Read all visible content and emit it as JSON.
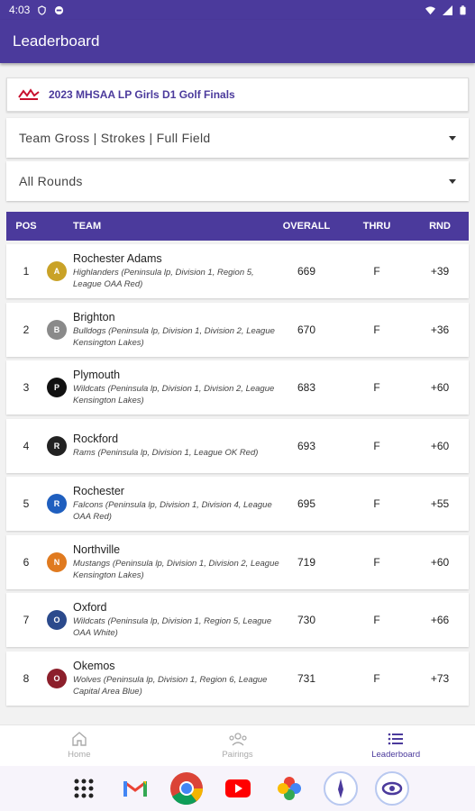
{
  "status": {
    "time": "4:03"
  },
  "appbar": {
    "title": "Leaderboard"
  },
  "event": {
    "title": "2023 MHSAA LP Girls D1 Golf Finals"
  },
  "filters": {
    "view": "Team Gross | Strokes | Full Field",
    "rounds": "All Rounds"
  },
  "table": {
    "headers": {
      "pos": "POS",
      "team": "TEAM",
      "overall": "OVERALL",
      "thru": "THRU",
      "rnd": "RND"
    },
    "rows": [
      {
        "pos": "1",
        "name": "Rochester Adams",
        "desc": "Highlanders (Peninsula lp, Division 1, Region 5, League OAA Red)",
        "overall": "669",
        "thru": "F",
        "rnd": "+39",
        "logo_color": "#c9a227",
        "logo_text": "A"
      },
      {
        "pos": "2",
        "name": "Brighton",
        "desc": "Bulldogs (Peninsula lp, Division 1, Division 2, League Kensington Lakes)",
        "overall": "670",
        "thru": "F",
        "rnd": "+36",
        "logo_color": "#8a8a8a",
        "logo_text": "B"
      },
      {
        "pos": "3",
        "name": "Plymouth",
        "desc": "Wildcats (Peninsula lp, Division 1, Division 2, League Kensington Lakes)",
        "overall": "683",
        "thru": "F",
        "rnd": "+60",
        "logo_color": "#111111",
        "logo_text": "P"
      },
      {
        "pos": "4",
        "name": "Rockford",
        "desc": "Rams (Peninsula lp, Division 1, League OK Red)",
        "overall": "693",
        "thru": "F",
        "rnd": "+60",
        "logo_color": "#222222",
        "logo_text": "R"
      },
      {
        "pos": "5",
        "name": "Rochester",
        "desc": "Falcons (Peninsula lp, Division 1, Division 4, League OAA Red)",
        "overall": "695",
        "thru": "F",
        "rnd": "+55",
        "logo_color": "#1f5fbf",
        "logo_text": "R"
      },
      {
        "pos": "6",
        "name": "Northville",
        "desc": "Mustangs (Peninsula lp, Division 1, Division 2, League Kensington Lakes)",
        "overall": "719",
        "thru": "F",
        "rnd": "+60",
        "logo_color": "#e07a1f",
        "logo_text": "N"
      },
      {
        "pos": "7",
        "name": "Oxford",
        "desc": "Wildcats (Peninsula lp, Division 1, Region 5, League OAA White)",
        "overall": "730",
        "thru": "F",
        "rnd": "+66",
        "logo_color": "#2b4a8c",
        "logo_text": "O"
      },
      {
        "pos": "8",
        "name": "Okemos",
        "desc": "Wolves (Peninsula lp, Division 1, Region 6, League Capital Area Blue)",
        "overall": "731",
        "thru": "F",
        "rnd": "+73",
        "logo_color": "#8c1f2b",
        "logo_text": "O"
      }
    ]
  },
  "nav": {
    "home": "Home",
    "pairings": "Pairings",
    "leaderboard": "Leaderboard"
  },
  "dock": [
    "apps-grid-icon",
    "gmail-icon",
    "chrome-icon",
    "youtube-icon",
    "photos-icon",
    "app-icon-1",
    "app-icon-2"
  ],
  "colors": {
    "primary": "#4b3a9c"
  }
}
